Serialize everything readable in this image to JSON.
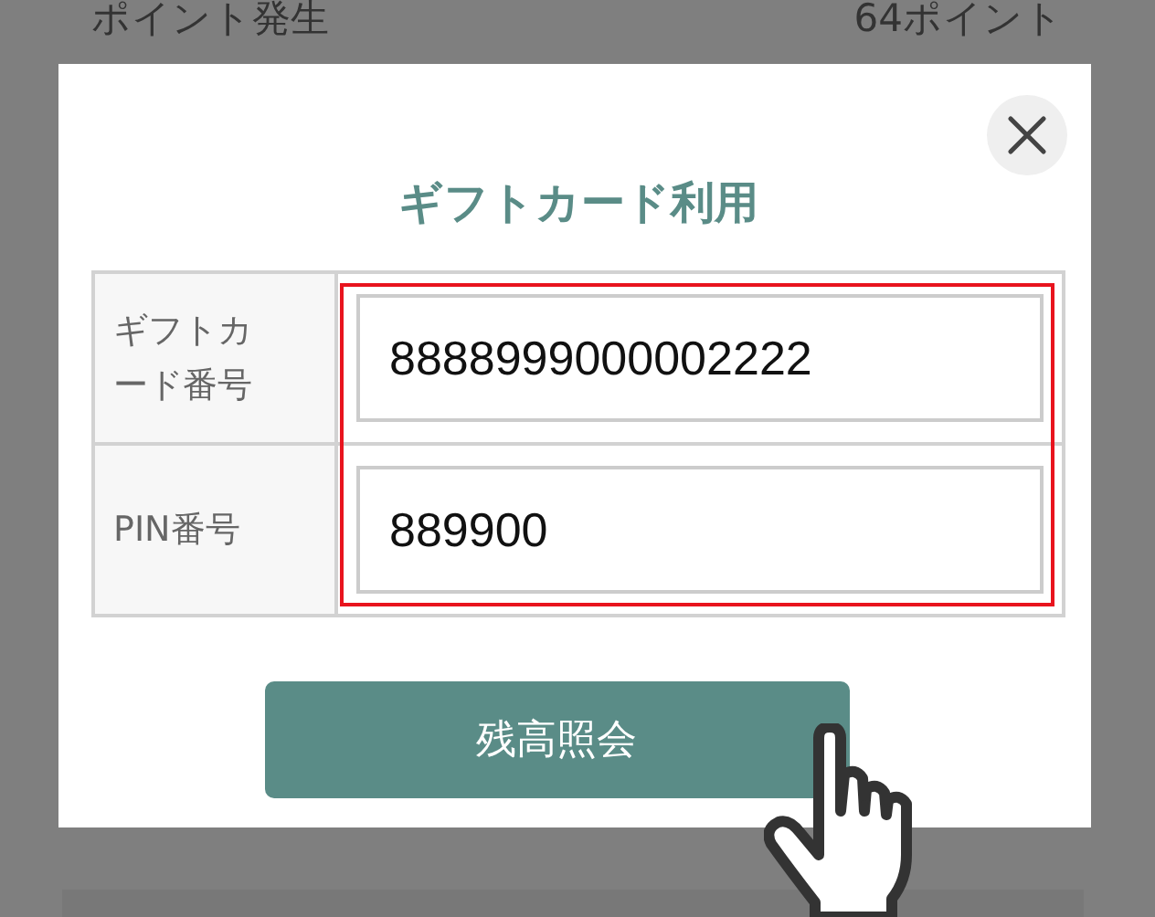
{
  "background_row": {
    "label": "ポイント発生",
    "value": "64ポイント"
  },
  "dialog": {
    "title": "ギフトカード利用",
    "fields": [
      {
        "label": "ギフトカード番号",
        "value": "8888999000002222"
      },
      {
        "label": "PIN番号",
        "value": "889900"
      }
    ],
    "button": "残高照会"
  }
}
